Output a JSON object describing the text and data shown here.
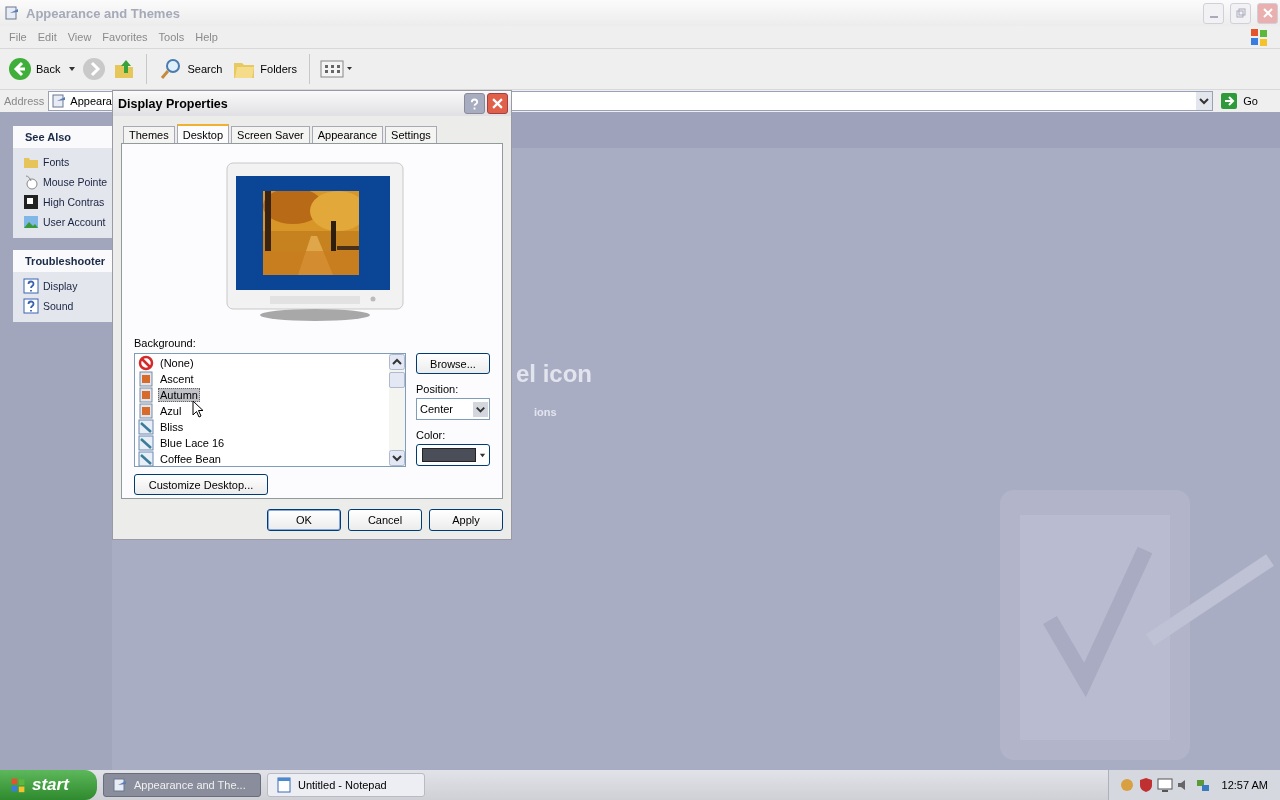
{
  "window": {
    "title": "Appearance and Themes"
  },
  "menu": [
    "File",
    "Edit",
    "View",
    "Favorites",
    "Tools",
    "Help"
  ],
  "toolbar": {
    "back": "Back",
    "search": "Search",
    "folders": "Folders"
  },
  "address": {
    "label": "Address",
    "value": "Appeara",
    "go": "Go"
  },
  "sidebar": [
    {
      "title": "See Also",
      "items": [
        {
          "label": "Fonts",
          "kind": "folder"
        },
        {
          "label": "Mouse Pointe",
          "kind": "mouse"
        },
        {
          "label": "High Contras",
          "kind": "contrast"
        },
        {
          "label": "User Account",
          "kind": "picture"
        }
      ]
    },
    {
      "title": "Troubleshooter",
      "items": [
        {
          "label": "Display",
          "kind": "help"
        },
        {
          "label": "Sound",
          "kind": "help"
        }
      ]
    }
  ],
  "content": {
    "heading": "el icon",
    "subheading": "ions"
  },
  "dialog": {
    "title": "Display Properties",
    "tabs": [
      {
        "label": "Themes",
        "selected": false
      },
      {
        "label": "Desktop",
        "selected": true
      },
      {
        "label": "Screen Saver",
        "selected": false
      },
      {
        "label": "Appearance",
        "selected": false
      },
      {
        "label": "Settings",
        "selected": false
      }
    ],
    "background_label": "Background:",
    "backgrounds": [
      {
        "label": "(None)",
        "kind": "none",
        "selected": false
      },
      {
        "label": "Ascent",
        "selected": false
      },
      {
        "label": "Autumn",
        "selected": true
      },
      {
        "label": "Azul",
        "selected": false
      },
      {
        "label": "Bliss",
        "kind": "bitmap",
        "selected": false
      },
      {
        "label": "Blue Lace 16",
        "kind": "bitmap",
        "selected": false
      },
      {
        "label": "Coffee Bean",
        "kind": "bitmap",
        "selected": false
      }
    ],
    "browse": "Browse...",
    "position_label": "Position:",
    "position": "Center",
    "color_label": "Color:",
    "color": "#4a4e58",
    "customize": "Customize Desktop...",
    "buttons": [
      "OK",
      "Cancel",
      "Apply"
    ]
  },
  "taskbar": {
    "start": "start",
    "tasks": [
      {
        "label": "Appearance and The...",
        "selected": true
      },
      {
        "label": "Untitled - Notepad",
        "selected": false
      }
    ],
    "clock": "12:57 AM"
  }
}
